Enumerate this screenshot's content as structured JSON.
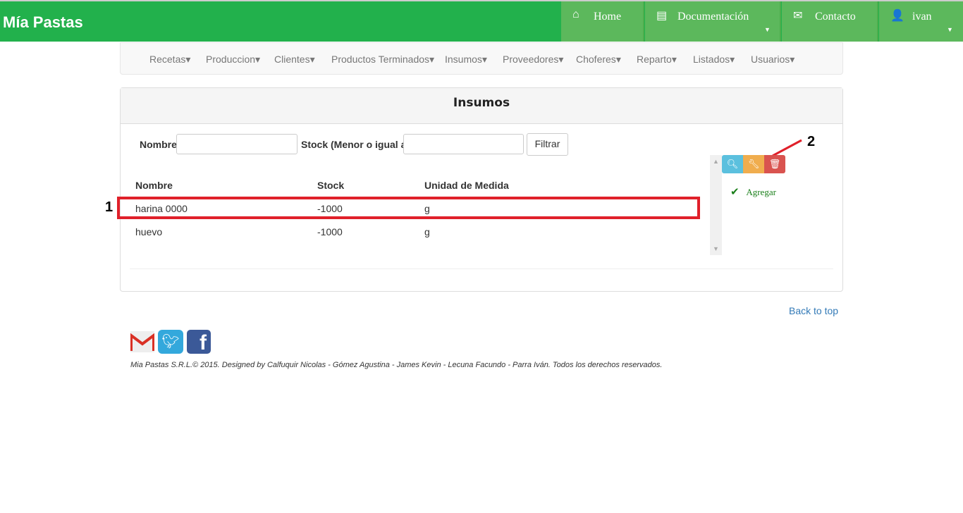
{
  "brand": "Mía Pastas",
  "topnav": [
    {
      "label": "Home",
      "icon": "home-icon"
    },
    {
      "label": "Documentación",
      "icon": "list-icon"
    },
    {
      "label": "Contacto",
      "icon": "envelope-icon"
    },
    {
      "label": "ivan",
      "icon": "user-icon"
    }
  ],
  "subnav": [
    "Recetas",
    "Produccion",
    "Clientes",
    "Productos Terminados",
    "Insumos",
    "Proveedores",
    "Choferes",
    "Reparto",
    "Listados",
    "Usuarios"
  ],
  "panel": {
    "title": "Insumos",
    "filter": {
      "nombre_label": "Nombre",
      "nombre_value": "",
      "stock_label": "Stock (Menor o igual a)",
      "stock_value": "",
      "button": "Filtrar"
    },
    "columns": [
      "Nombre",
      "Stock",
      "Unidad de Medida"
    ],
    "rows": [
      [
        "harina 0000",
        "-1000",
        "g"
      ],
      [
        "huevo",
        "-1000",
        "g"
      ]
    ],
    "add_label": "Agregar"
  },
  "annotations": [
    "1",
    "2"
  ],
  "back_to_top": "Back to top",
  "footer": "Mia Pastas S.R.L.© 2015. Designed by Calfuquir Nicolas - Gómez Agustina - James Kevin - Lecuna Facundo - Parra Iván. Todos los derechos reservados.",
  "colors": {
    "topbar": "#22b14c",
    "nav": "#5cb85c",
    "info": "#5bc0de",
    "warning": "#f0ad4e",
    "danger": "#d9534f",
    "annotation": "#e0202a"
  }
}
